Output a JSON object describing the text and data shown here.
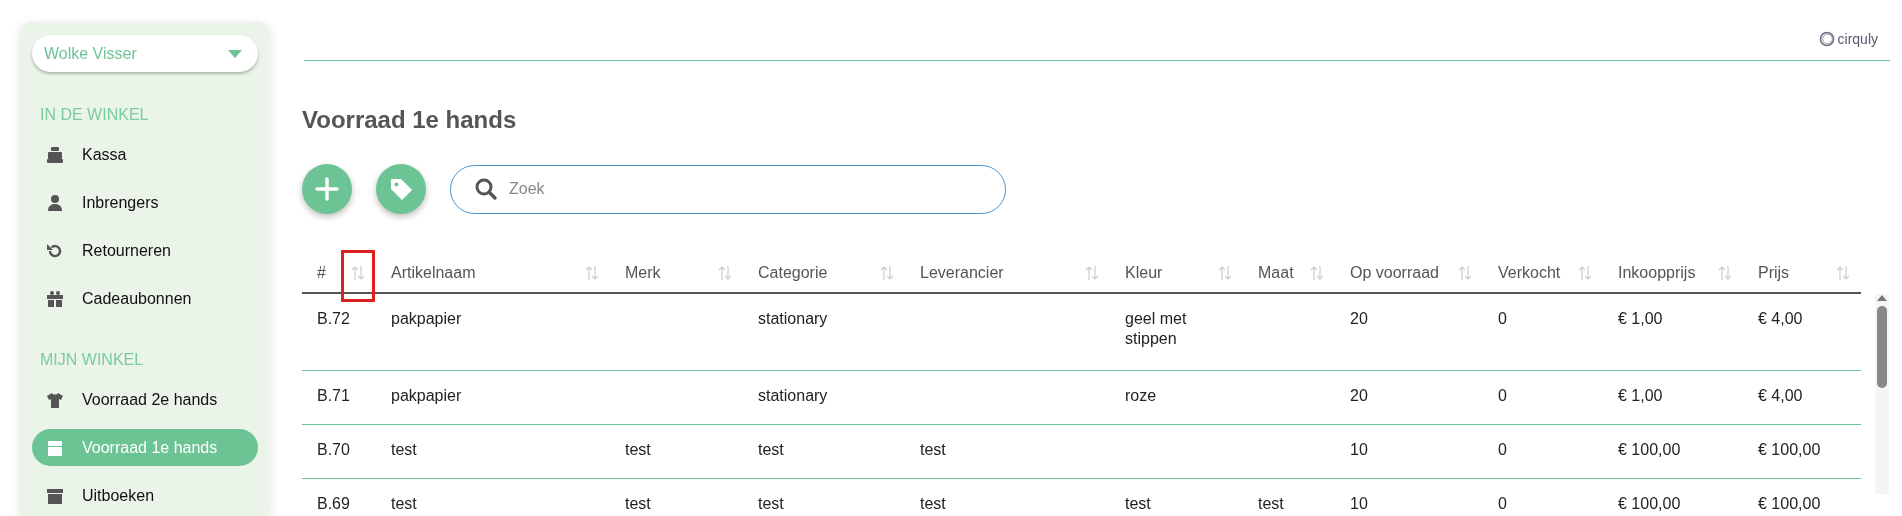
{
  "sidebar": {
    "user_dropdown": {
      "value": "Wolke Visser"
    },
    "sections": [
      {
        "heading": "IN DE WINKEL",
        "items": [
          {
            "label": "Kassa",
            "selected": false
          },
          {
            "label": "Inbrengers",
            "selected": false
          },
          {
            "label": "Retourneren",
            "selected": false
          },
          {
            "label": "Cadeaubonnen",
            "selected": false
          }
        ]
      },
      {
        "heading": "MIJN WINKEL",
        "items": [
          {
            "label": "Voorraad 2e hands",
            "selected": false
          },
          {
            "label": "Voorraad 1e hands",
            "selected": true
          },
          {
            "label": "Uitboeken",
            "selected": false
          }
        ]
      }
    ]
  },
  "header": {
    "logo": "cirquly"
  },
  "page_title": "Voorraad 1e hands",
  "search": {
    "placeholder": "Zoek"
  },
  "table": {
    "columns": [
      {
        "label": "#",
        "highlighted": true
      },
      {
        "label": "Artikelnaam",
        "highlighted": false
      },
      {
        "label": "Merk",
        "highlighted": false
      },
      {
        "label": "Categorie",
        "highlighted": false
      },
      {
        "label": "Leverancier",
        "highlighted": false
      },
      {
        "label": "Kleur",
        "highlighted": false
      },
      {
        "label": "Maat",
        "highlighted": false
      },
      {
        "label": "Op voorraad",
        "highlighted": false
      },
      {
        "label": "Verkocht",
        "highlighted": false
      },
      {
        "label": "Inkoopprijs",
        "highlighted": false
      },
      {
        "label": "Prijs",
        "highlighted": false
      }
    ],
    "rows": [
      [
        "B.72",
        "pakpapier",
        null,
        "stationary",
        null,
        "geel met stippen",
        null,
        "20",
        "0",
        "€ 1,00",
        "€ 4,00"
      ],
      [
        "B.71",
        "pakpapier",
        null,
        "stationary",
        null,
        "roze",
        null,
        "20",
        "0",
        "€ 1,00",
        "€ 4,00"
      ],
      [
        "B.70",
        "test",
        "test",
        "test",
        "test",
        null,
        null,
        "10",
        "0",
        "€ 100,00",
        "€ 100,00"
      ],
      [
        "B.69",
        "test",
        "test",
        "test",
        "test",
        "test",
        "test",
        "10",
        "0",
        "€ 100,00",
        "€ 100,00"
      ]
    ]
  }
}
